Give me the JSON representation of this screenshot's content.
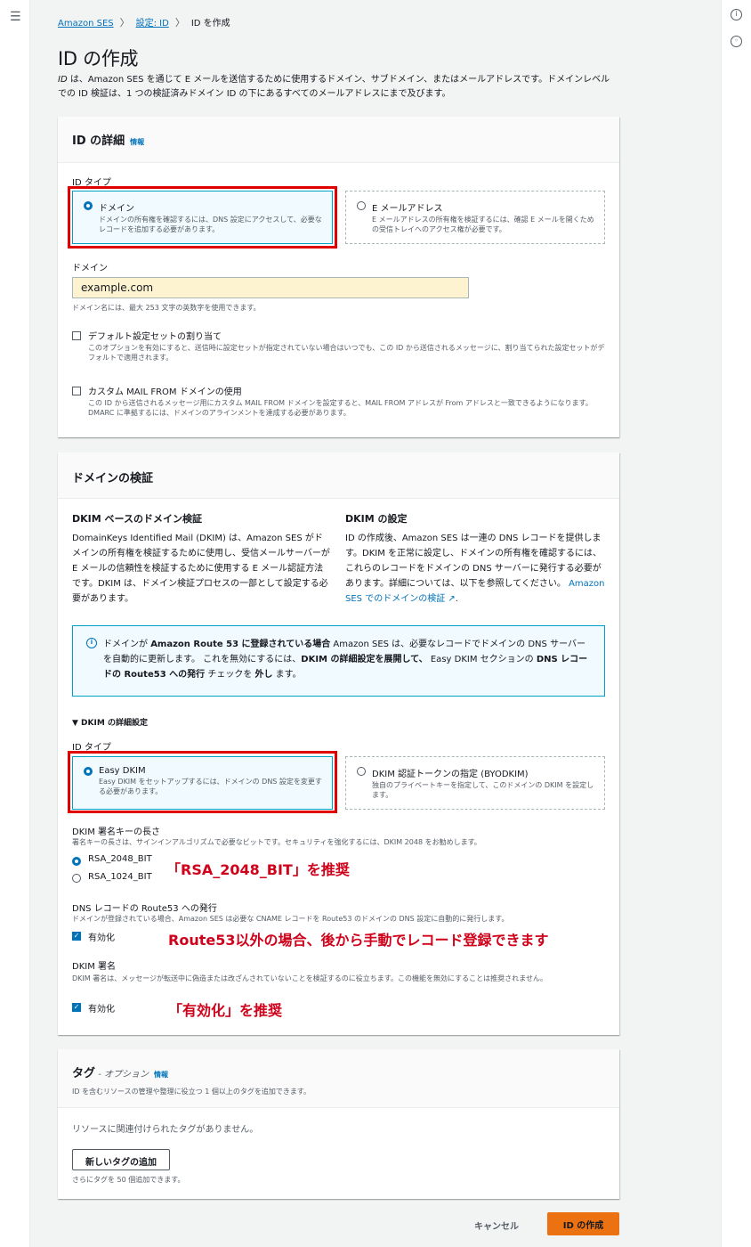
{
  "breadcrumb": {
    "items": [
      "Amazon SES",
      "設定: ID",
      "ID を作成"
    ]
  },
  "page": {
    "title": "ID の作成",
    "description_italic": "ID",
    "description": " は、Amazon SES を通じて E メールを送信するために使用するドメイン、サブドメイン、またはメールアドレスです。ドメインレベルでの ID 検証は、1 つの検証済みドメイン ID の下にあるすべてのメールアドレスにまで及びます。"
  },
  "identity_details": {
    "header": "ID の詳細",
    "info": "情報",
    "id_type_label": "ID タイプ",
    "tile_domain": {
      "title": "ドメイン",
      "desc": "ドメインの所有権を確認するには、DNS 設定にアクセスして、必要なレコードを追加する必要があります。",
      "selected": true
    },
    "tile_email": {
      "title": "E メールアドレス",
      "desc": "E メールアドレスの所有権を検証するには、確認 E メールを開くための受信トレイへのアクセス権が必要です。",
      "selected": false
    },
    "domain_label": "ドメイン",
    "domain_value": "example.com",
    "domain_hint": "ドメイン名には、最大 253 文字の英数字を使用できます。",
    "default_config": {
      "label": "デフォルト設定セットの割り当て",
      "desc": "このオプションを有効にすると、送信時に設定セットが指定されていない場合はいつでも、この ID から送信されるメッセージに、割り当てられた設定セットがデフォルトで適用されます。"
    },
    "custom_mail_from": {
      "label": "カスタム MAIL FROM ドメインの使用",
      "desc": "この ID から送信されるメッセージ用にカスタム MAIL FROM ドメインを設定すると、MAIL FROM アドレスが From アドレスと一致できるようになります。DMARC に準拠するには、ドメインのアラインメントを達成する必要があります。"
    }
  },
  "domain_verification": {
    "header": "ドメインの検証",
    "dkim_col1_title": "DKIM ベースのドメイン検証",
    "dkim_col1_text": "DomainKeys Identified Mail (DKIM) は、Amazon SES がドメインの所有権を検証するために使用し、受信メールサーバーが E メールの信頼性を検証するために使用する E メール認証方法です。DKIM は、ドメイン検証プロセスの一部として設定する必要があります。",
    "dkim_col2_title": "DKIM の設定",
    "dkim_col2_text": "ID の作成後、Amazon SES は一連の DNS レコードを提供します。DKIM を正常に設定し、ドメインの所有権を確認するには、これらのレコードをドメインの DNS サーバーに発行する必要があります。詳細については、以下を参照してください。",
    "dkim_col2_link": "Amazon SES でのドメインの検証 ↗",
    "dkim_col2_tail": ".",
    "alert": {
      "t1": "ドメインが ",
      "b1": "Amazon Route 53 に登録されている場合",
      "t2": " Amazon SES は、必要なレコードでドメインの DNS サーバーを自動的に更新します。 これを無効にするには、",
      "b2": "DKIM の詳細設定を展開して、",
      "t3": " Easy DKIM セクションの ",
      "b3": "DNS レコードの Route53 への発行",
      "t4": " チェックを ",
      "b4": "外し",
      "t5": " ます。"
    },
    "advanced_toggle": "▼ DKIM の詳細設定",
    "id_type_label": "ID タイプ",
    "tile_easy": {
      "title": "Easy DKIM",
      "desc": "Easy DKIM をセットアップするには、ドメインの DNS 設定を変更する必要があります。"
    },
    "tile_byodkim": {
      "title": "DKIM 認証トークンの指定 (BYODKIM)",
      "desc": "独自のプライベートキーを指定して、このドメインの DKIM を設定します。"
    },
    "key_length_label": "DKIM 署名キーの長さ",
    "key_length_desc": "署名キーの長さは、サインインアルゴリズムで必要なビットです。セキュリティを強化するには、DKIM 2048 をお勧めします。",
    "key_2048": "RSA_2048_BIT",
    "key_1024": "RSA_1024_BIT",
    "annot_rsa": "「RSA_2048_BIT」を推奨",
    "route53_label": "DNS レコードの Route53 への発行",
    "route53_desc": "ドメインが登録されている場合、Amazon SES は必要な CNAME レコードを Route53 のドメインの DNS 設定に自動的に発行します。",
    "route53_cb": "有効化",
    "annot_route53": "Route53以外の場合、後から手動でレコード登録できます",
    "signing_label": "DKIM 署名",
    "signing_desc": "DKIM 署名は、メッセージが転送中に偽造または改ざんされていないことを検証するのに役立ちます。この機能を無効にすることは推奨されません。",
    "signing_cb": "有効化",
    "annot_signing": "「有効化」を推奨"
  },
  "tags": {
    "header": "タグ",
    "optional": " - オプション",
    "info": "情報",
    "desc": "ID を含むリソースの管理や整理に役立つ 1 個以上のタグを追加できます。",
    "empty": "リソースに関連付けられたタグがありません。",
    "add_button": "新しいタグの追加",
    "limit": "さらにタグを 50 個追加できます。"
  },
  "footer": {
    "cancel": "キャンセル",
    "create": "ID の作成"
  },
  "colors": {
    "accent": "#0073bb",
    "primary_button": "#ec7211",
    "annotation": "#d0021b"
  }
}
